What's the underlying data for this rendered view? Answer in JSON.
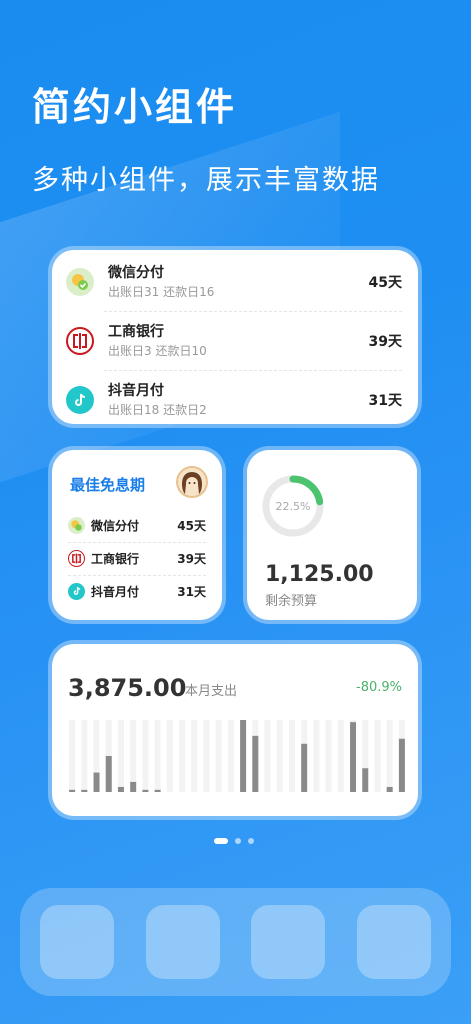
{
  "header": {
    "title": "简约小组件",
    "subtitle": "多种小组件，展示丰富数据"
  },
  "card_list": {
    "items": [
      {
        "name": "微信分付",
        "sub": "出账日31 还款日16",
        "days": "45天",
        "icon": "wechat-pay-icon"
      },
      {
        "name": "工商银行",
        "sub": "出账日3 还款日10",
        "days": "39天",
        "icon": "icbc-bank-icon"
      },
      {
        "name": "抖音月付",
        "sub": "出账日18 还款日2",
        "days": "31天",
        "icon": "douyin-pay-icon"
      }
    ]
  },
  "best_free_period": {
    "title": "最佳免息期",
    "items": [
      {
        "name": "微信分付",
        "days": "45天"
      },
      {
        "name": "工商银行",
        "days": "39天"
      },
      {
        "name": "抖音月付",
        "days": "31天"
      }
    ]
  },
  "budget": {
    "percent_label": "22.5%",
    "percent": 22.5,
    "amount": "1,125.00",
    "label": "剩余预算"
  },
  "monthly_spend": {
    "amount": "3,875.00",
    "label": "本月支出",
    "change": "-80.9%",
    "bar_levels": [
      0.03,
      0.03,
      0.27,
      0.5,
      0.07,
      0.14,
      0.03,
      0.03,
      0,
      0,
      0,
      0,
      0,
      0,
      1.0,
      0.78,
      0,
      0,
      0,
      0.67,
      0,
      0,
      0,
      0.97,
      0.33,
      0,
      0.07,
      0.74
    ]
  },
  "pager": {
    "count": 3,
    "active": 0
  },
  "dock": {
    "slots": 4
  },
  "colors": {
    "accent": "#1a7ee8",
    "positive": "#4bb36a",
    "donut": "#4cc46f",
    "bar": "#8a8a8a"
  }
}
